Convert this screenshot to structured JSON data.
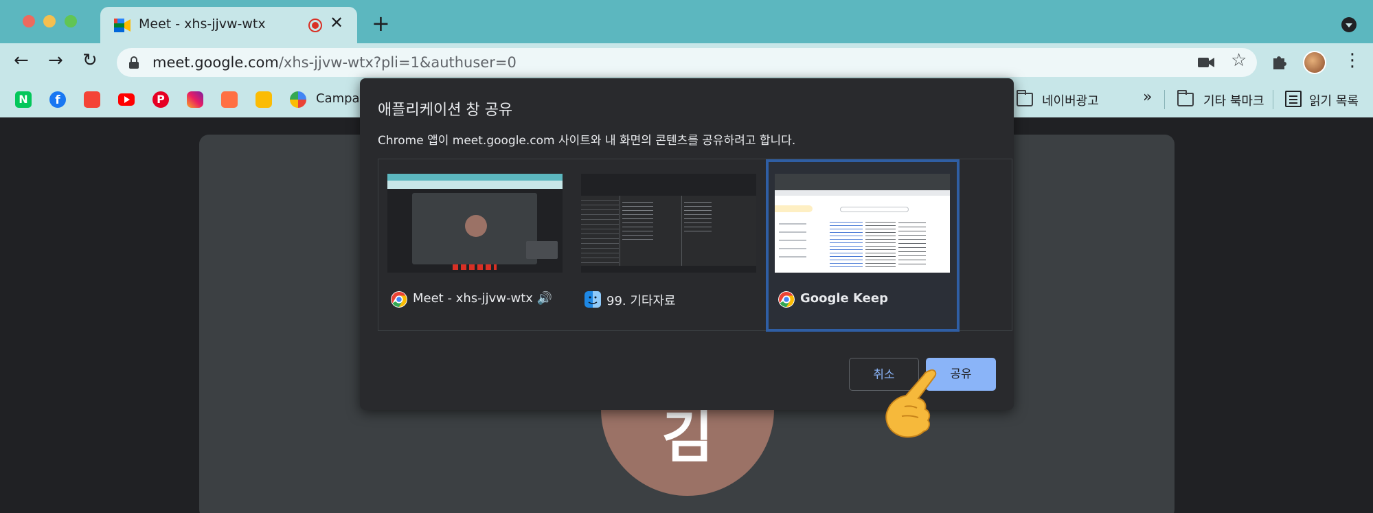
{
  "browser": {
    "tab": {
      "title": "Meet - xhs-jjvw-wtx"
    },
    "url": {
      "host": "meet.google.com",
      "path": "/xhs-jjvw-wtx?pli=1&authuser=0"
    }
  },
  "bookmarks": [
    {
      "label": "Campai"
    },
    {
      "label": "네이버광고"
    },
    {
      "label": "»"
    },
    {
      "label": "기타 북마크"
    },
    {
      "label": "읽기 목록"
    }
  ],
  "meeting": {
    "avatar_letter": "김"
  },
  "dialog": {
    "title": "애플리케이션 창 공유",
    "description": "Chrome 앱이 meet.google.com 사이트와 내 화면의 콘텐츠를 공유하려고 합니다.",
    "sources": [
      {
        "label": "Meet - xhs-jjvw-wtx 🔊",
        "selected": false
      },
      {
        "label": "99. 기타자료",
        "selected": false
      },
      {
        "label": "Google Keep",
        "selected": true
      }
    ],
    "cancel_label": "취소",
    "share_label": "공유"
  },
  "colors": {
    "accent": "#8ab4f8",
    "selected_border": "#2f5ea4",
    "tabstrip": "#5cb7bf",
    "toolbar": "#c7e6e8"
  }
}
